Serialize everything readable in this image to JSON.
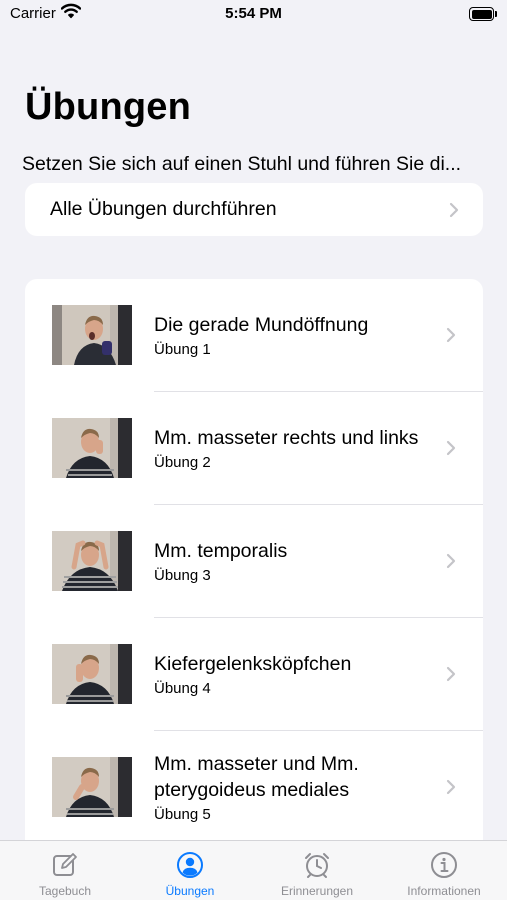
{
  "status_bar": {
    "carrier": "Carrier",
    "time": "5:54 PM"
  },
  "header": {
    "title": "Übungen"
  },
  "intro": {
    "text": "Setzen Sie sich auf einen Stuhl und führen Sie di..."
  },
  "all_exercises": {
    "label": "Alle Übungen durchführen"
  },
  "exercises": [
    {
      "title": "Die gerade Mundöffnung",
      "subtitle": "Übung 1"
    },
    {
      "title": "Mm. masseter rechts und links",
      "subtitle": "Übung 2"
    },
    {
      "title": "Mm. temporalis",
      "subtitle": "Übung 3"
    },
    {
      "title": "Kiefergelenksköpfchen",
      "subtitle": "Übung 4"
    },
    {
      "title": "Mm. masseter und Mm. pterygoideus mediales",
      "subtitle": "Übung 5"
    }
  ],
  "tab_bar": {
    "tabs": [
      {
        "label": "Tagebuch",
        "icon": "compose-icon",
        "active": false
      },
      {
        "label": "Übungen",
        "icon": "person-circle-icon",
        "active": true
      },
      {
        "label": "Erinnerungen",
        "icon": "alarm-clock-icon",
        "active": false
      },
      {
        "label": "Informationen",
        "icon": "info-circle-icon",
        "active": false
      }
    ]
  },
  "colors": {
    "accent": "#0a7aff",
    "inactive": "#8e8e93",
    "background": "#f2f2f7",
    "card": "#ffffff"
  }
}
